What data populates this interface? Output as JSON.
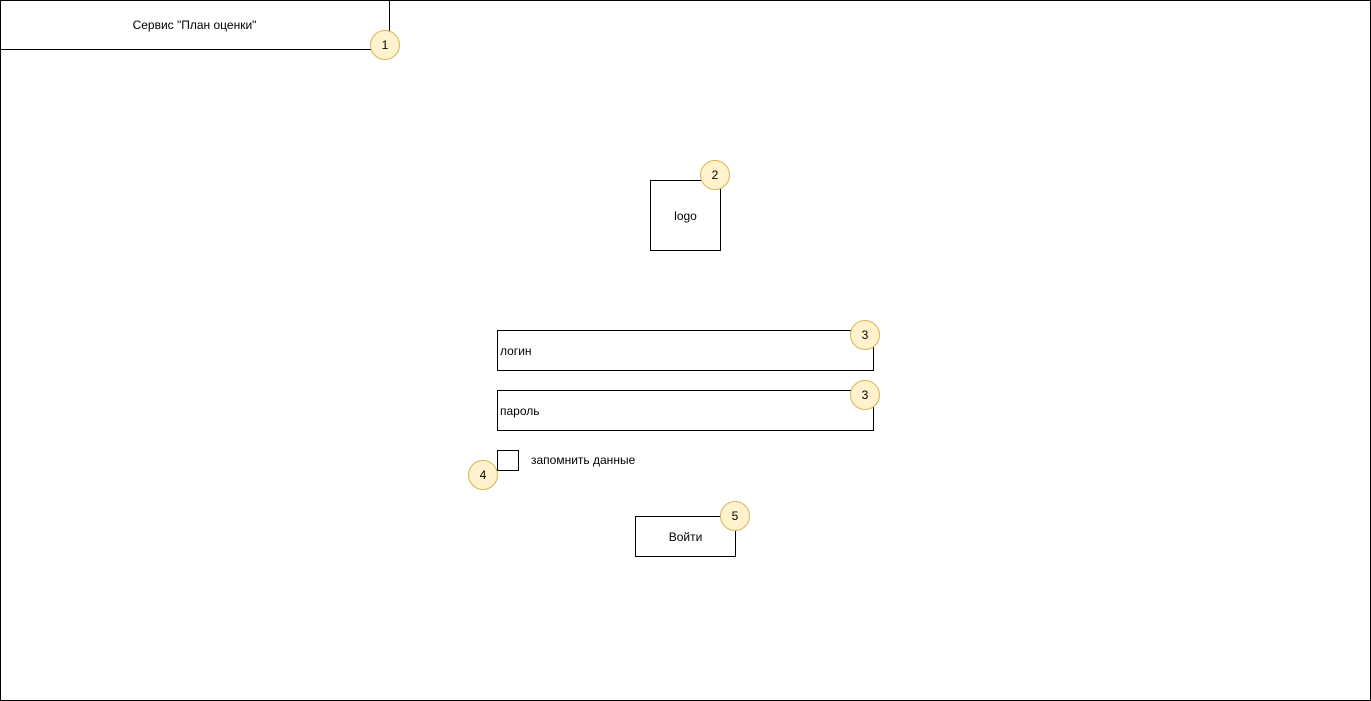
{
  "header": {
    "title": "Сервис \"План оценки\""
  },
  "logo": {
    "label": "logo"
  },
  "form": {
    "login_label": "логин",
    "password_label": "пароль",
    "remember_label": "запомнить данные",
    "submit_label": "Войти"
  },
  "markers": {
    "header": "1",
    "logo": "2",
    "login": "3",
    "password": "3",
    "remember": "4",
    "submit": "5"
  },
  "colors": {
    "marker_fill": "#fff2cc",
    "marker_border": "#d6b656",
    "line": "#000000"
  }
}
